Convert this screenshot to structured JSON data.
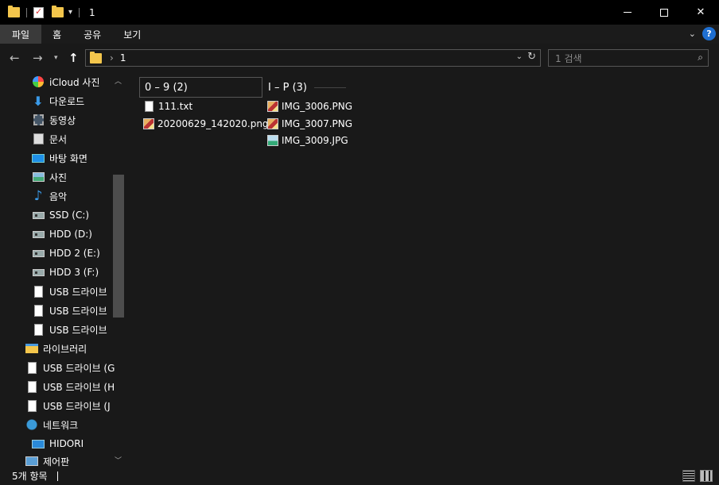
{
  "window": {
    "title": "1",
    "controls": {
      "minimize": "—",
      "maximize": "☐",
      "close": "✕"
    }
  },
  "ribbon": {
    "tabs": [
      "파일",
      "홈",
      "공유",
      "보기"
    ],
    "help": "?"
  },
  "address": {
    "path": "1",
    "search_placeholder": "1 검색"
  },
  "navpane": {
    "items": [
      {
        "label": "iCloud 사진",
        "icon": "icloud-photos-icon"
      },
      {
        "label": "다운로드",
        "icon": "download-icon"
      },
      {
        "label": "동영상",
        "icon": "video-icon"
      },
      {
        "label": "문서",
        "icon": "documents-icon"
      },
      {
        "label": "바탕 화면",
        "icon": "desktop-icon"
      },
      {
        "label": "사진",
        "icon": "pictures-icon"
      },
      {
        "label": "음악",
        "icon": "music-icon"
      },
      {
        "label": "SSD (C:)",
        "icon": "drive-icon"
      },
      {
        "label": "HDD (D:)",
        "icon": "drive-icon"
      },
      {
        "label": "HDD 2 (E:)",
        "icon": "drive-icon"
      },
      {
        "label": "HDD 3 (F:)",
        "icon": "drive-icon"
      },
      {
        "label": "USB 드라이브",
        "icon": "usb-drive-icon"
      },
      {
        "label": "USB 드라이브",
        "icon": "usb-drive-icon"
      },
      {
        "label": "USB 드라이브",
        "icon": "usb-drive-icon"
      },
      {
        "label": "라이브러리",
        "icon": "library-icon"
      },
      {
        "label": "USB 드라이브 (G",
        "icon": "usb-drive-icon"
      },
      {
        "label": "USB 드라이브 (H",
        "icon": "usb-drive-icon"
      },
      {
        "label": "USB 드라이브 (J",
        "icon": "usb-drive-icon"
      },
      {
        "label": "네트워크",
        "icon": "network-icon"
      },
      {
        "label": "HIDORI",
        "icon": "computer-icon"
      },
      {
        "label": "제어판",
        "icon": "control-panel-icon"
      }
    ]
  },
  "groups": [
    {
      "header": "0 – 9 (2)",
      "files": [
        {
          "name": "111.txt",
          "type": "txt"
        },
        {
          "name": "20200629_142020.png",
          "type": "png"
        }
      ]
    },
    {
      "header": "I – P (3)",
      "files": [
        {
          "name": "IMG_3006.PNG",
          "type": "png"
        },
        {
          "name": "IMG_3007.PNG",
          "type": "png"
        },
        {
          "name": "IMG_3009.JPG",
          "type": "jpg"
        }
      ]
    }
  ],
  "status": {
    "item_count": "5개 항목"
  }
}
